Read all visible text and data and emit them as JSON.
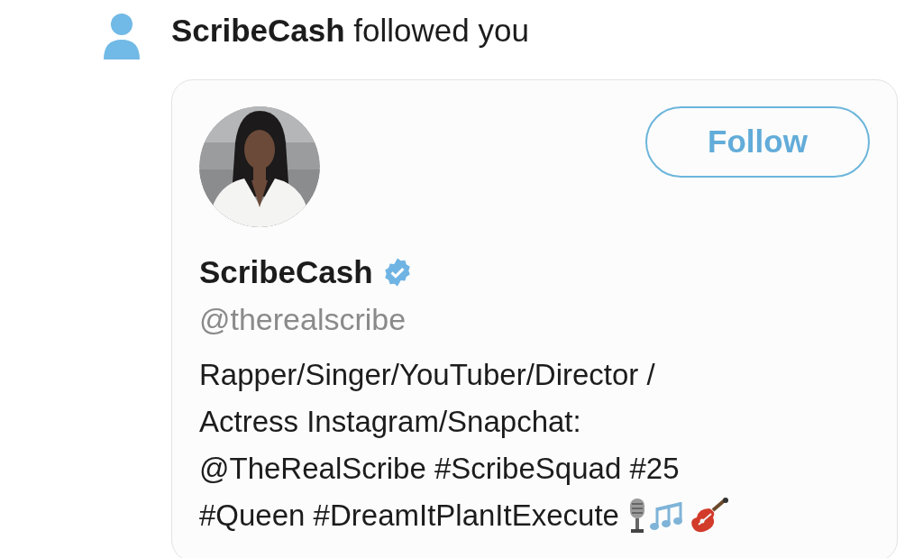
{
  "notification": {
    "actor": "ScribeCash",
    "action": "followed you"
  },
  "card": {
    "name": "ScribeCash",
    "verified": true,
    "handle": "@therealscribe",
    "follow_button": "Follow",
    "bio_lines": [
      "Rapper/Singer/YouTuber/Director /",
      "Actress Instagram/Snapchat:",
      "@TheRealScribe #ScribeSquad #25",
      "#Queen #DreamItPlanItExecute"
    ]
  }
}
